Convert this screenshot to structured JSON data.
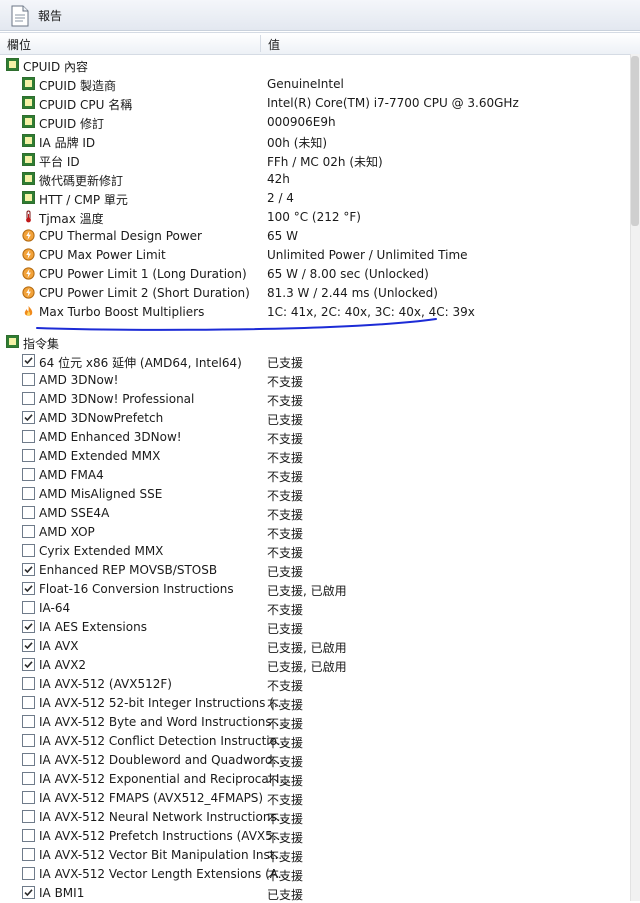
{
  "window": {
    "title": "報告",
    "icon": "document-icon"
  },
  "header": {
    "col_field": "欄位",
    "col_value": "值"
  },
  "sections": [
    {
      "label": "CPUID 內容",
      "icon": "chip-icon",
      "items": [
        {
          "label": "CPUID 製造商",
          "value": "GenuineIntel",
          "icon": "chip-icon"
        },
        {
          "label": "CPUID CPU 名稱",
          "value": "Intel(R) Core(TM) i7-7700 CPU @ 3.60GHz",
          "icon": "chip-icon"
        },
        {
          "label": "CPUID 修訂",
          "value": "000906E9h",
          "icon": "chip-icon"
        },
        {
          "label": "IA 品牌 ID",
          "value": "00h (未知)",
          "icon": "chip-icon"
        },
        {
          "label": "平台 ID",
          "value": "FFh / MC 02h (未知)",
          "icon": "chip-icon"
        },
        {
          "label": "微代碼更新修訂",
          "value": "42h",
          "icon": "chip-icon"
        },
        {
          "label": "HTT / CMP 單元",
          "value": "2 / 4",
          "icon": "chip-icon"
        },
        {
          "label": "Tjmax 溫度",
          "value": "100 °C (212 °F)",
          "icon": "thermometer-icon"
        },
        {
          "label": "CPU Thermal Design Power",
          "value": "65 W",
          "icon": "power-icon"
        },
        {
          "label": "CPU Max Power Limit",
          "value": "Unlimited Power / Unlimited Time",
          "icon": "power-icon"
        },
        {
          "label": "CPU Power Limit 1 (Long Duration)",
          "value": "65 W / 8.00 sec (Unlocked)",
          "icon": "power-icon"
        },
        {
          "label": "CPU Power Limit 2 (Short Duration)",
          "value": "81.3 W / 2.44 ms (Unlocked)",
          "icon": "power-icon"
        },
        {
          "label": "Max Turbo Boost Multipliers",
          "value": "1C: 41x, 2C: 40x, 3C: 40x, 4C: 39x",
          "icon": "flame-icon"
        }
      ]
    },
    {
      "label": "指令集",
      "icon": "chip-icon",
      "items": [
        {
          "label": "64 位元 x86 延伸 (AMD64, Intel64)",
          "value": "已支援",
          "checked": true
        },
        {
          "label": "AMD 3DNow!",
          "value": "不支援",
          "checked": false
        },
        {
          "label": "AMD 3DNow! Professional",
          "value": "不支援",
          "checked": false
        },
        {
          "label": "AMD 3DNowPrefetch",
          "value": "已支援",
          "checked": true
        },
        {
          "label": "AMD Enhanced 3DNow!",
          "value": "不支援",
          "checked": false
        },
        {
          "label": "AMD Extended MMX",
          "value": "不支援",
          "checked": false
        },
        {
          "label": "AMD FMA4",
          "value": "不支援",
          "checked": false
        },
        {
          "label": "AMD MisAligned SSE",
          "value": "不支援",
          "checked": false
        },
        {
          "label": "AMD SSE4A",
          "value": "不支援",
          "checked": false
        },
        {
          "label": "AMD XOP",
          "value": "不支援",
          "checked": false
        },
        {
          "label": "Cyrix Extended MMX",
          "value": "不支援",
          "checked": false
        },
        {
          "label": "Enhanced REP MOVSB/STOSB",
          "value": "已支援",
          "checked": true
        },
        {
          "label": "Float-16 Conversion Instructions",
          "value": "已支援, 已啟用",
          "checked": true
        },
        {
          "label": "IA-64",
          "value": "不支援",
          "checked": false
        },
        {
          "label": "IA AES Extensions",
          "value": "已支援",
          "checked": true
        },
        {
          "label": "IA AVX",
          "value": "已支援, 已啟用",
          "checked": true
        },
        {
          "label": "IA AVX2",
          "value": "已支援, 已啟用",
          "checked": true
        },
        {
          "label": "IA AVX-512 (AVX512F)",
          "value": "不支援",
          "checked": false
        },
        {
          "label": "IA AVX-512 52-bit Integer Instructions (...",
          "value": "不支援",
          "checked": false
        },
        {
          "label": "IA AVX-512 Byte and Word Instructions ...",
          "value": "不支援",
          "checked": false
        },
        {
          "label": "IA AVX-512 Conflict Detection Instructio...",
          "value": "不支援",
          "checked": false
        },
        {
          "label": "IA AVX-512 Doubleword and Quadword...",
          "value": "不支援",
          "checked": false
        },
        {
          "label": "IA AVX-512 Exponential and Reciprocal I...",
          "value": "不支援",
          "checked": false
        },
        {
          "label": "IA AVX-512 FMAPS (AVX512_4FMAPS)",
          "value": "不支援",
          "checked": false
        },
        {
          "label": "IA AVX-512 Neural Network Instructions...",
          "value": "不支援",
          "checked": false
        },
        {
          "label": "IA AVX-512 Prefetch Instructions (AVX5...",
          "value": "不支援",
          "checked": false
        },
        {
          "label": "IA AVX-512 Vector Bit Manipulation Inst...",
          "value": "不支援",
          "checked": false
        },
        {
          "label": "IA AVX-512 Vector Length Extensions (A...",
          "value": "不支援",
          "checked": false
        },
        {
          "label": "IA BMI1",
          "value": "已支援",
          "checked": true
        }
      ]
    }
  ],
  "annotation_color": "#1c2bd6"
}
